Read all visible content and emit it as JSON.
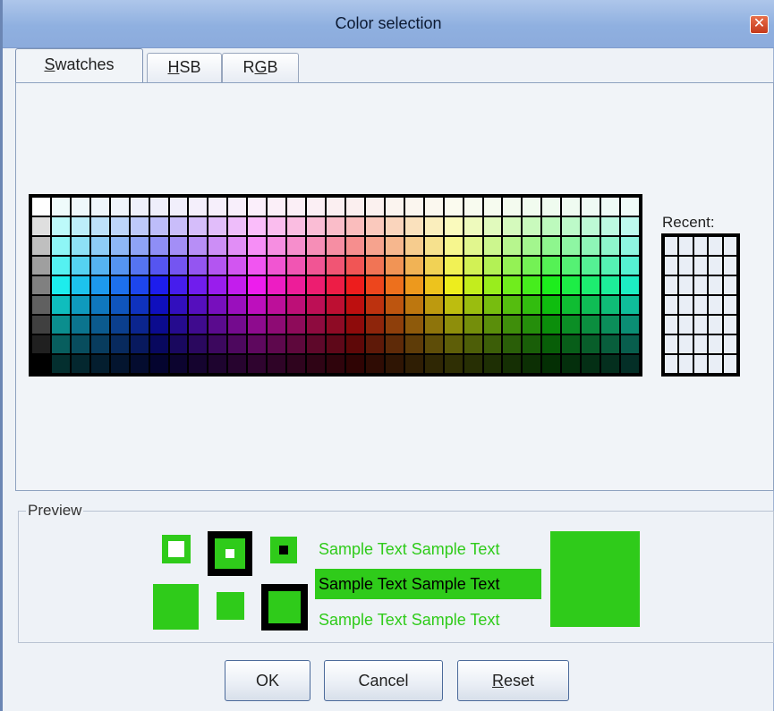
{
  "window": {
    "title": "Color selection"
  },
  "tabs": [
    {
      "label": "Swatches",
      "mnemonic_index": 0
    },
    {
      "label": "HSB",
      "mnemonic_index": 0
    },
    {
      "label": "RGB",
      "mnemonic_index": 1
    }
  ],
  "recent": {
    "label": "Recent:"
  },
  "preview": {
    "label": "Preview",
    "selected_color": "#2fcb1a",
    "sample_text": "Sample Text Sample Text"
  },
  "buttons": {
    "ok": "OK",
    "cancel": "Cancel",
    "reset": "Reset"
  }
}
